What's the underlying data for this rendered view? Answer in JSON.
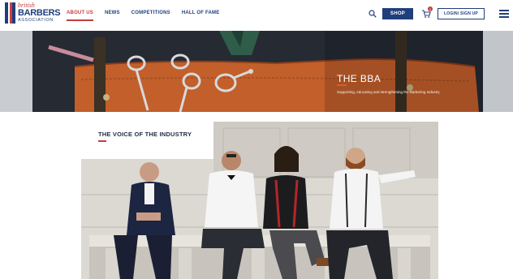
{
  "brand": {
    "line1": "british",
    "line2": "BARBERS",
    "line3": "ASSOCIATION",
    "colors": {
      "navy": "#1f3e7c",
      "red": "#c43d3d"
    }
  },
  "nav": {
    "items": [
      {
        "label": "ABOUT US",
        "active": true
      },
      {
        "label": "NEWS",
        "active": false
      },
      {
        "label": "COMPETITIONS",
        "active": false
      },
      {
        "label": "HALL OF FAME",
        "active": false
      }
    ]
  },
  "header_actions": {
    "search_icon": "search-icon",
    "shop_label": "SHOP",
    "cart_icon": "cart-icon",
    "cart_count": "0",
    "login_label": "LOGIN/ SIGN UP",
    "menu_icon": "hamburger-icon"
  },
  "hero": {
    "title": "THE BBA",
    "subtitle": "Supporting, educating and strengthening the Barbering Industry"
  },
  "voice": {
    "title": "THE VOICE OF THE INDUSTRY"
  }
}
